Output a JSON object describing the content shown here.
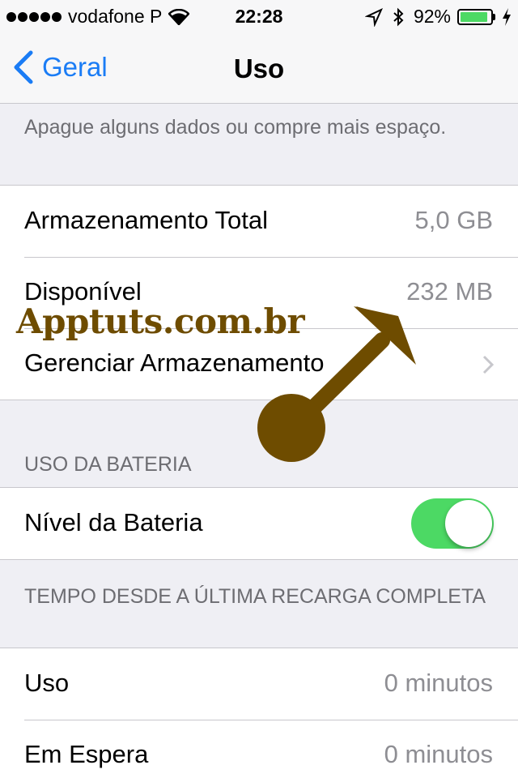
{
  "status_bar": {
    "carrier": "vodafone P",
    "time": "22:28",
    "battery_percent": "92%",
    "battery_level": 0.92
  },
  "nav": {
    "back_label": "Geral",
    "title": "Uso"
  },
  "storage": {
    "note": "Apague alguns dados ou compre mais espaço.",
    "total_label": "Armazenamento Total",
    "total_value": "5,0 GB",
    "available_label": "Disponível",
    "available_value": "232 MB",
    "manage_label": "Gerenciar Armazenamento"
  },
  "battery_usage": {
    "header": "USO DA BATERIA",
    "level_label": "Nível da Bateria",
    "level_toggle_on": true
  },
  "since_charge": {
    "header": "TEMPO DESDE A ÚLTIMA RECARGA COMPLETA",
    "usage_label": "Uso",
    "usage_value": "0 minutos",
    "standby_label": "Em Espera",
    "standby_value": "0 minutos"
  },
  "watermark": {
    "text": "Apptuts.com.br",
    "color": "#6e4c00"
  },
  "colors": {
    "accent": "#1a7cf5",
    "toggle_on": "#4cd964"
  }
}
